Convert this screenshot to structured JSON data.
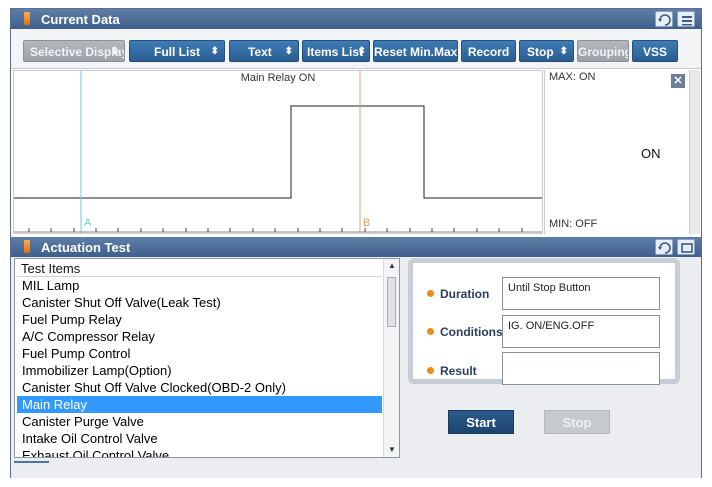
{
  "top_window": {
    "title": "Current Data",
    "retry_label": "Retry"
  },
  "toolbar": {
    "selective_display": "Selective Display",
    "full_list": "Full List",
    "text": "Text",
    "items_list": "Items List",
    "reset_min_max": "Reset Min.Max",
    "record": "Record",
    "stop": "Stop",
    "grouping": "Grouping",
    "vss": "VSS"
  },
  "graph": {
    "title": "Main Relay ON",
    "marker_a": "A",
    "marker_b": "B",
    "max_label": "MAX: ON",
    "min_label": "MIN: OFF",
    "current_value": "ON",
    "close_label": "✕"
  },
  "actuation": {
    "title": "Actuation Test",
    "retry_label": "Retry",
    "list_header": "Test Items",
    "items": [
      "MIL Lamp",
      "Canister Shut Off Valve(Leak Test)",
      "Fuel Pump Relay",
      "A/C Compressor Relay",
      "Fuel Pump Control",
      "Immobilizer Lamp(Option)",
      "Canister Shut Off Valve Clocked(OBD-2 Only)",
      "Main Relay",
      "Canister Purge Valve",
      "Intake Oil Control Valve",
      "Exhaust Oil Control Valve"
    ],
    "selected_item": "Main Relay",
    "duration_label": "Duration",
    "duration_value": "Until Stop Button",
    "conditions_label": "Conditions",
    "conditions_value": "IG. ON/ENG.OFF",
    "result_label": "Result",
    "result_value": "",
    "start_button": "Start",
    "stop_button": "Stop"
  },
  "colors": {
    "titlebar": "#4a6b96",
    "toolbar_button": "#2f6aa3",
    "selection": "#3399ff",
    "marker_a": "#66ccdd",
    "marker_b": "#d9a070",
    "accent_dot": "#f08a1a"
  }
}
